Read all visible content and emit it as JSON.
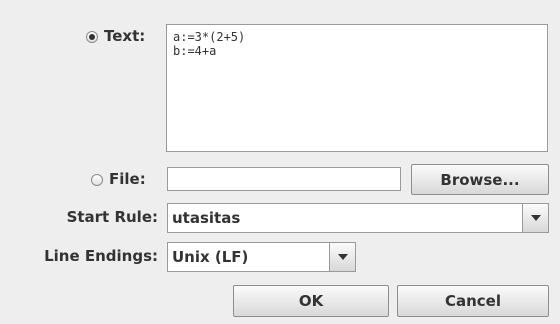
{
  "source": {
    "text_option_label": "Text:",
    "text_option_selected": true,
    "text_content": "a:=3*(2+5)\nb:=4+a",
    "file_option_label": "File:",
    "file_option_selected": false,
    "file_path_value": "",
    "browse_label": "Browse..."
  },
  "start_rule": {
    "label": "Start Rule:",
    "value": "utasitas"
  },
  "line_endings": {
    "label": "Line Endings:",
    "value": "Unix (LF)"
  },
  "actions": {
    "ok_label": "OK",
    "cancel_label": "Cancel"
  },
  "icons": {
    "dropdown_arrow": "chevron-down-icon",
    "radio": "radio-icon"
  }
}
